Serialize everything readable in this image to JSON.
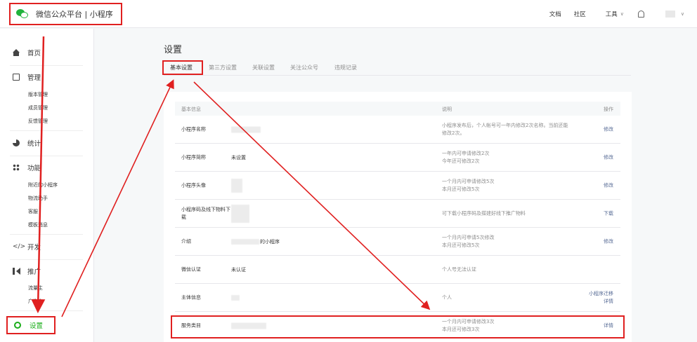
{
  "header": {
    "brand": "微信公众平台 | 小程序",
    "nav": [
      {
        "label": "文档"
      },
      {
        "label": "社区"
      },
      {
        "label": "工具"
      }
    ]
  },
  "sidebar": {
    "home": "首页",
    "manage": {
      "label": "管理",
      "items": [
        "版本管理",
        "成员管理",
        "反馈管理"
      ]
    },
    "stats": "统计",
    "features": {
      "label": "功能",
      "items": [
        "附近的小程序",
        "物流助手",
        "客服",
        "模板消息"
      ]
    },
    "dev": "开发",
    "promo": {
      "label": "推广",
      "items": [
        "流量主",
        "广告主"
      ]
    },
    "settings": "设置"
  },
  "main": {
    "title": "设置",
    "tabs": [
      "基本设置",
      "第三方设置",
      "关联设置",
      "关注公众号",
      "违规记录"
    ],
    "table": {
      "headers": {
        "info": "基本信息",
        "desc": "说明",
        "op": "操作"
      },
      "rows": [
        {
          "label": "小程序名称",
          "value": "",
          "desc": "小程序发布后，个人帐号可一年内修改2次名称。当前还能修改2次。",
          "op": "修改"
        },
        {
          "label": "小程序简称",
          "value": "未设置",
          "desc": "一年内可申请修改2次\n今年还可修改2次",
          "op": "修改"
        },
        {
          "label": "小程序头像",
          "value": "",
          "desc": "一个月内可申请修改5次\n本月还可修改5次",
          "op": "修改"
        },
        {
          "label": "小程序码及线下物料下载",
          "value": "",
          "desc": "可下载小程序码及搭建好线下推广物料",
          "op": "下载"
        },
        {
          "label": "介绍",
          "value": "的小程序",
          "desc": "一个月内可申请5次修改\n本月还可修改5次",
          "op": "修改"
        },
        {
          "label": "微信认证",
          "value": "未认证",
          "desc": "个人号无法认证",
          "op": ""
        },
        {
          "label": "主体信息",
          "value": "",
          "desc": "个人",
          "op": "小程序迁移\n详情"
        },
        {
          "label": "服务类目",
          "value": "",
          "desc": "一个月内可申请修改3次\n本月还可修改3次",
          "op": "详情"
        }
      ]
    }
  },
  "colors": {
    "accent": "#1aad19",
    "link": "#576b95",
    "annotation": "#e02020"
  }
}
